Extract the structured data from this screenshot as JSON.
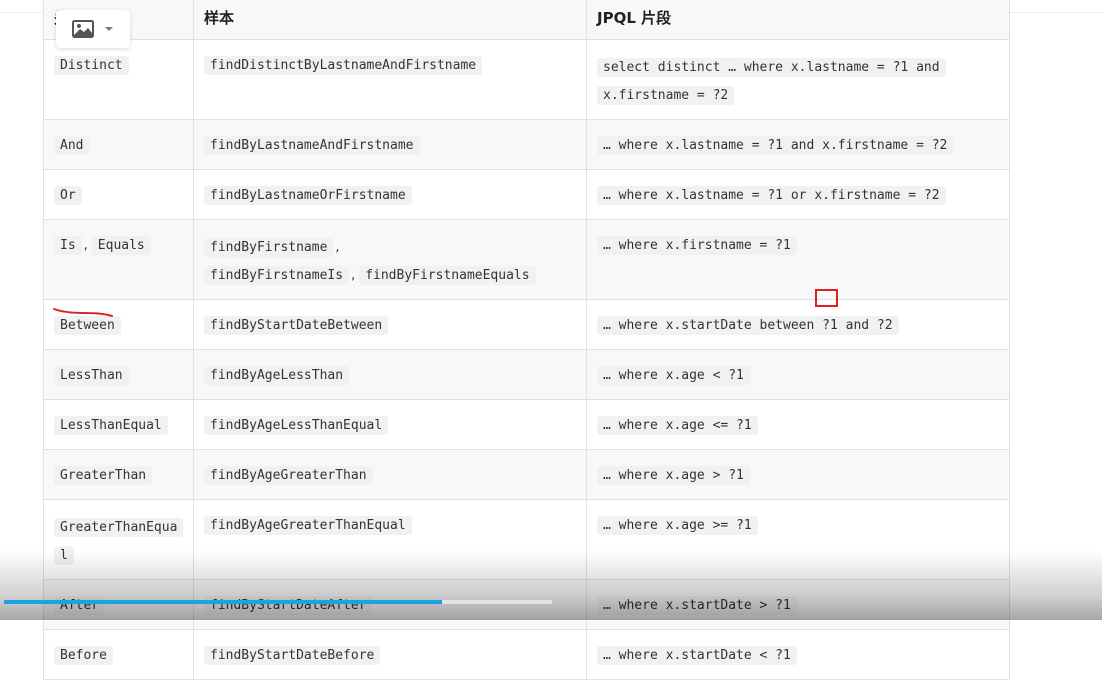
{
  "header": {
    "col1": "关键词",
    "col2": "样本",
    "col3": "JPQL 片段"
  },
  "rows": [
    {
      "keyword": [
        "Distinct"
      ],
      "sample": [
        "findDistinctByLastnameAndFirstname"
      ],
      "jpql": [
        "select distinct … where x.lastname = ?1 and",
        "x.firstname = ?2"
      ]
    },
    {
      "keyword": [
        "And"
      ],
      "sample": [
        "findByLastnameAndFirstname"
      ],
      "jpql": [
        "… where x.lastname = ?1 and x.firstname = ?2"
      ]
    },
    {
      "keyword": [
        "Or"
      ],
      "sample": [
        "findByLastnameOrFirstname"
      ],
      "jpql": [
        "… where x.lastname = ?1 or x.firstname = ?2"
      ]
    },
    {
      "keyword": [
        "Is",
        "Equals"
      ],
      "sample": [
        "findByFirstname",
        "findByFirstnameIs",
        "findByFirstnameEquals"
      ],
      "jpql": [
        "… where x.firstname = ?1"
      ]
    },
    {
      "keyword": [
        "Between"
      ],
      "sample": [
        "findByStartDateBetween"
      ],
      "jpql": [
        "… where x.startDate between ?1 and ?2"
      ]
    },
    {
      "keyword": [
        "LessThan"
      ],
      "sample": [
        "findByAgeLessThan"
      ],
      "jpql": [
        "… where x.age < ?1"
      ]
    },
    {
      "keyword": [
        "LessThanEqual"
      ],
      "sample": [
        "findByAgeLessThanEqual"
      ],
      "jpql": [
        "… where x.age <= ?1"
      ]
    },
    {
      "keyword": [
        "GreaterThan"
      ],
      "sample": [
        "findByAgeGreaterThan"
      ],
      "jpql": [
        "… where x.age > ?1"
      ]
    },
    {
      "keyword": [
        "GreaterThanEqua",
        "l"
      ],
      "sample": [
        "findByAgeGreaterThanEqual"
      ],
      "jpql": [
        "… where x.age >= ?1"
      ]
    },
    {
      "keyword": [
        "After"
      ],
      "sample": [
        "findByStartDateAfter"
      ],
      "jpql": [
        "… where x.startDate > ?1"
      ]
    },
    {
      "keyword": [
        "Before"
      ],
      "sample": [
        "findByStartDateBefore"
      ],
      "jpql": [
        "… where x.startDate < ?1"
      ]
    }
  ],
  "image_control": {
    "icon": "image-icon",
    "dropdown_icon": "chevron-down-icon"
  },
  "annotations": {
    "box_color": "#e02020",
    "underline_color": "#e02020"
  },
  "video": {
    "progress_fraction": 0.8,
    "accent": "#1aa3e0"
  }
}
